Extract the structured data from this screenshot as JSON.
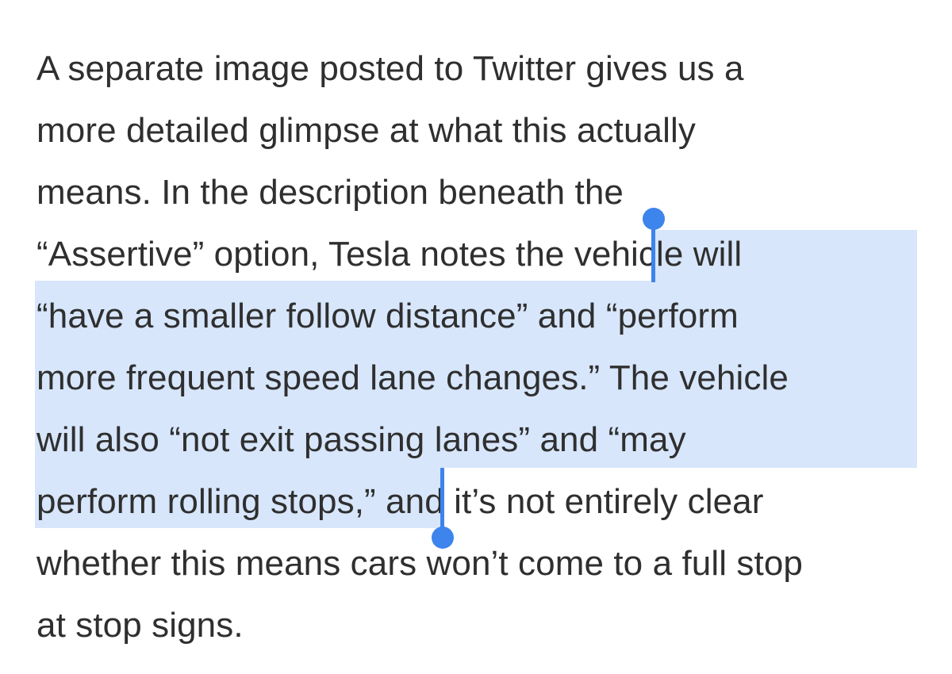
{
  "article": {
    "lines": [
      {
        "plain": "A separate image posted to Twitter gives us a"
      },
      {
        "plain": "more detailed glimpse at what this actually"
      },
      {
        "plain": "means. In the description beneath the"
      },
      {
        "plain": "“Assertive” option, Tesla notes the ",
        "selected": "vehicle will"
      },
      {
        "selected": "“have a smaller follow distance” and “perform"
      },
      {
        "selected": "more frequent speed lane changes.” The vehicle"
      },
      {
        "selected": "will also “not exit passing lanes” and “may"
      },
      {
        "selected": "perform rolling stops,” ",
        "plain_after": "and it’s not entirely clear"
      },
      {
        "plain": "whether this means cars won’t come to a full stop"
      },
      {
        "plain": "at stop signs."
      }
    ]
  },
  "selection": {
    "highlight_color": "#d7e6fb",
    "handle_color": "#3d84ec"
  }
}
